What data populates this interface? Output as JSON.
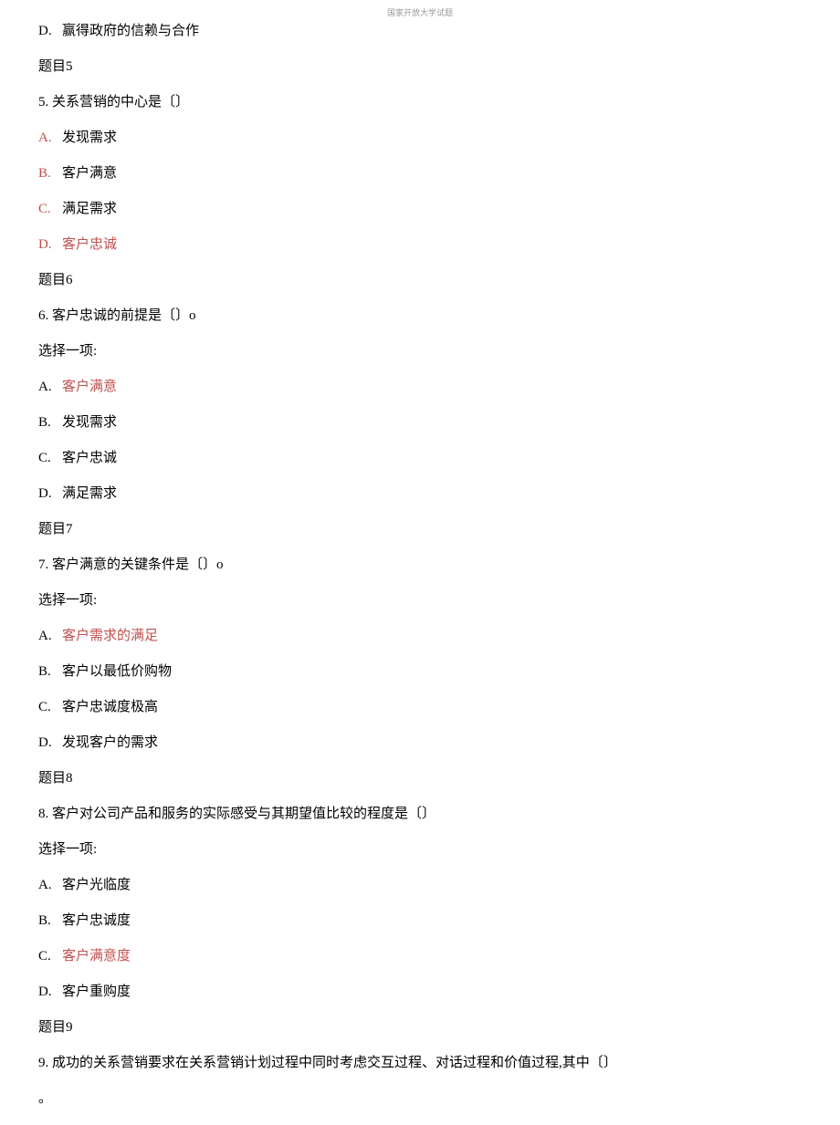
{
  "watermark": "国家开放大学试题",
  "lines": [
    {
      "type": "option",
      "letter": "D.",
      "letterClass": "",
      "text": "赢得政府的信赖与合作",
      "textClass": ""
    },
    {
      "type": "heading",
      "text": "题目5"
    },
    {
      "type": "stem",
      "text": "5. 关系营销的中心是〔〕"
    },
    {
      "type": "option",
      "letter": "A.",
      "letterClass": "red",
      "text": "发现需求",
      "textClass": ""
    },
    {
      "type": "option",
      "letter": "B.",
      "letterClass": "red",
      "text": "客户满意",
      "textClass": ""
    },
    {
      "type": "option",
      "letter": "C.",
      "letterClass": "red",
      "text": "满足需求",
      "textClass": ""
    },
    {
      "type": "option",
      "letter": "D.",
      "letterClass": "red",
      "text": "客户忠诚",
      "textClass": "red"
    },
    {
      "type": "heading",
      "text": "题目6"
    },
    {
      "type": "stem",
      "text": "6. 客户忠诚的前提是〔〕o"
    },
    {
      "type": "plain",
      "text": "选择一项:"
    },
    {
      "type": "option",
      "letter": "A.",
      "letterClass": "",
      "text": "客户满意",
      "textClass": "red"
    },
    {
      "type": "option",
      "letter": "B.",
      "letterClass": "",
      "text": "发现需求",
      "textClass": ""
    },
    {
      "type": "option",
      "letter": "C.",
      "letterClass": "",
      "text": "客户忠诚",
      "textClass": ""
    },
    {
      "type": "option",
      "letter": "D.",
      "letterClass": "",
      "text": "满足需求",
      "textClass": ""
    },
    {
      "type": "heading",
      "text": "题目7"
    },
    {
      "type": "stem",
      "text": "7. 客户满意的关键条件是〔〕o"
    },
    {
      "type": "plain",
      "text": "选择一项:"
    },
    {
      "type": "option",
      "letter": "A.",
      "letterClass": "",
      "text": "客户需求的满足",
      "textClass": "red"
    },
    {
      "type": "option",
      "letter": "B.",
      "letterClass": "",
      "text": "客户以最低价购物",
      "textClass": ""
    },
    {
      "type": "option",
      "letter": "C.",
      "letterClass": "",
      "text": "客户忠诚度极高",
      "textClass": ""
    },
    {
      "type": "option",
      "letter": "D.",
      "letterClass": "",
      "text": "发现客户的需求",
      "textClass": ""
    },
    {
      "type": "heading",
      "text": "题目8"
    },
    {
      "type": "stem",
      "text": "8. 客户对公司产品和服务的实际感受与其期望值比较的程度是〔〕"
    },
    {
      "type": "plain",
      "text": "选择一项:"
    },
    {
      "type": "option",
      "letter": "A.",
      "letterClass": "",
      "text": "客户光临度",
      "textClass": ""
    },
    {
      "type": "option",
      "letter": "B.",
      "letterClass": "",
      "text": "客户忠诚度",
      "textClass": ""
    },
    {
      "type": "option",
      "letter": "C.",
      "letterClass": "",
      "text": "客户满意度",
      "textClass": "red"
    },
    {
      "type": "option",
      "letter": "D.",
      "letterClass": "",
      "text": "客户重购度",
      "textClass": ""
    },
    {
      "type": "heading",
      "text": "题目9"
    },
    {
      "type": "stem",
      "text": "9. 成功的关系营销要求在关系营销计划过程中同时考虑交互过程、对话过程和价值过程,其中〔〕"
    },
    {
      "type": "plain",
      "text": "。"
    }
  ]
}
